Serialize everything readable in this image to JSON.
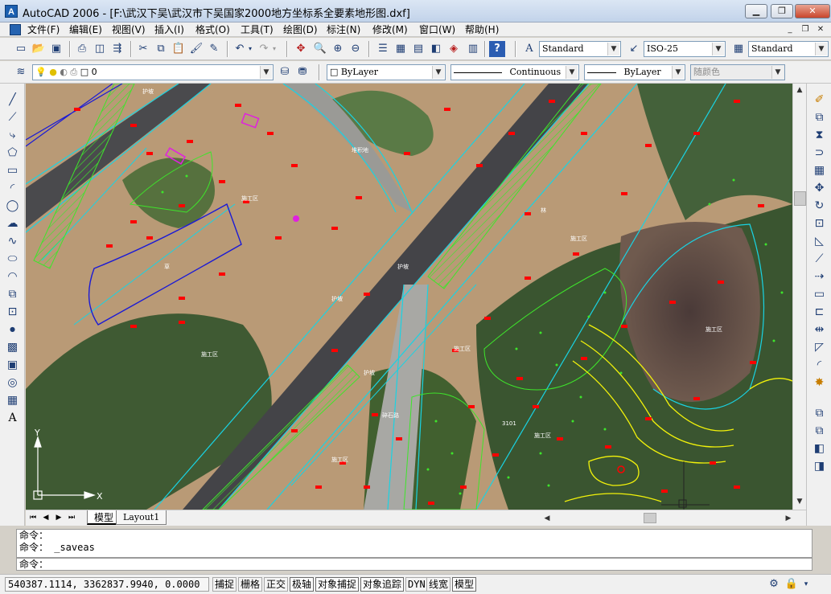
{
  "window": {
    "title": "AutoCAD 2006 - [F:\\武汉下吴\\武汉市下吴国家2000地方坐标系全要素地形图.dxf]",
    "app_icon": "A",
    "minimize": "▁",
    "restore": "❐",
    "close": "✕"
  },
  "menubar": {
    "items": [
      "文件(F)",
      "编辑(E)",
      "视图(V)",
      "插入(I)",
      "格式(O)",
      "工具(T)",
      "绘图(D)",
      "标注(N)",
      "修改(M)",
      "窗口(W)",
      "帮助(H)"
    ],
    "mdi_minimize": "_",
    "mdi_restore": "❐",
    "mdi_close": "✕"
  },
  "toolbar1": {
    "text_style": "Standard",
    "dim_style": "ISO-25",
    "table_style": "Standard"
  },
  "toolbar2": {
    "layer": "0",
    "color": "ByLayer",
    "linetype": "Continuous",
    "lineweight": "ByLayer",
    "plot_style": "随颜色"
  },
  "map_labels": [
    {
      "text": "护坡"
    },
    {
      "text": "堆积地"
    },
    {
      "text": "施工区"
    },
    {
      "text": "林"
    },
    {
      "text": "护坡"
    },
    {
      "text": "草"
    },
    {
      "text": "施工区"
    },
    {
      "text": "施工区"
    },
    {
      "text": "施工区"
    },
    {
      "text": "护坡"
    },
    {
      "text": "施工区"
    },
    {
      "text": "施工区"
    },
    {
      "text": "护坡"
    },
    {
      "text": "碎石路"
    },
    {
      "text": "施工区"
    },
    {
      "text": "3101"
    }
  ],
  "ucs": {
    "y": "Y",
    "x": "X"
  },
  "tabs": {
    "model": "模型",
    "layout1": "Layout1"
  },
  "command": {
    "history": [
      "命令：",
      "命令： _saveas"
    ],
    "prompt": "命令："
  },
  "status": {
    "coordinates": "540387.1114,  3362837.9940,  0.0000",
    "buttons": [
      "捕捉",
      "栅格",
      "正交",
      "极轴",
      "对象捕捉",
      "对象追踪",
      "DYN",
      "线宽",
      "模型"
    ]
  },
  "colors": {
    "accent": "#1b5fb0",
    "road_outline": "#19d3e3",
    "hatch_green": "#3ee52b",
    "marker_red": "#ff0000",
    "contour_yellow": "#f2f20a",
    "polygon_blue": "#1a1ad6"
  }
}
